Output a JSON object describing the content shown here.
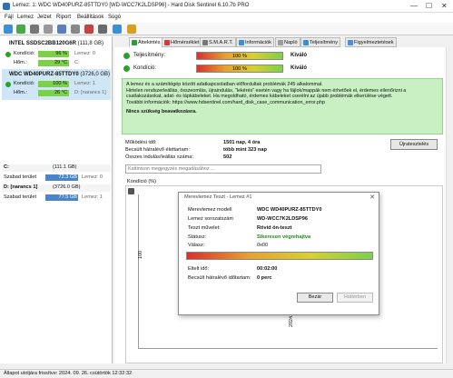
{
  "window": {
    "title": "Lemez: 1: WDC WD40PURZ-85TTDY0 [WD-WCC7K2LDSP96]  -  Hard Disk Sentinel 6.10.7b PRO",
    "controls": [
      "—",
      "☐",
      "✕"
    ]
  },
  "menu": [
    "Fájl",
    "Lemez",
    "Jelzet",
    "Riport",
    "Beállítások",
    "Súgó"
  ],
  "disks": [
    {
      "name": "INTEL SSDSC2BB120G6R",
      "size": "(111,8 GB)",
      "condition_label": "Kondíció:",
      "condition": "96 %",
      "condition_side": "Lemez: 0",
      "temp_label": "Hőm.:",
      "temp": "29 °C",
      "temp_side": "C:"
    },
    {
      "name": "WDC WD40PURZ-85TTDY0",
      "size": "(3726,0 GB)",
      "condition_label": "Kondíció:",
      "condition": "100 %",
      "condition_side": "Lemez: 1",
      "temp_label": "Hőm.:",
      "temp": "26 °C",
      "temp_side": "D: [narancs 1]"
    }
  ],
  "drives": [
    {
      "letter": "C:",
      "capacity": "(111.1 GB)",
      "free_label": "Szabad terület",
      "free": "72.3 GB",
      "disk": "Lemez: 0"
    },
    {
      "letter": "D: [narancs 1]",
      "capacity": "(3726.0 GB)",
      "free_label": "Szabad terület",
      "free": "77.5 GB",
      "disk": "Lemez: 1"
    }
  ],
  "tabs": [
    "Áttekintés",
    "Hőmérséklet",
    "S.M.A.R.T.",
    "Információk",
    "Napló",
    "Teljesítmény",
    "Figyelmeztetések"
  ],
  "overview": {
    "performance_label": "Teljesítmény:",
    "performance": "100 %",
    "performance_status": "Kiváló",
    "condition_label": "Kondíció:",
    "condition": "100 %",
    "condition_status": "Kiváló",
    "info_lines": [
      "A lemez és a számítógép között adatkapcsolatban előfordultak problémák 245 alkalommal.",
      "Hirtelen rendszerleállás, összeomlás, újraindulás, \"lekérés\" esetén vagy ha fájlok/mappák nem érhetőek el, érdemes ellenőrizni a",
      "csatlakozásokat, adat- és tápkábeleket. Ha megoldható, érdemes kábeleket cserélni az újabb problémák elkerülése végett.",
      "További információk: https://www.hdsentinel.com/hard_disk_case_communication_error.php"
    ],
    "info_note": "Nincs szükség beavatkozásra.",
    "power_on_label": "Működési idő:",
    "power_on": "1501 nap, 4 óra",
    "remaining_label": "Becsült hátralévő élettartam:",
    "remaining": "több mint 323 nap",
    "starts_label": "Összes indulás/leállás száma:",
    "starts": "502",
    "notify_button": "Újratesztelés",
    "comment_placeholder": "Kattintson megjegyzés megadásához ...",
    "chart_label": "Kondíció  (%)"
  },
  "chart_data": {
    "type": "line",
    "y_ticks": [
      "100"
    ],
    "x_ticks": [
      "2024. 09. 26."
    ]
  },
  "dialog": {
    "title": "Merevlemez Teszt - Lemez #1",
    "model_label": "Merevlemez modell",
    "model": "WDC WD40PURZ-85TTDY0",
    "serial_label": "Lemez sorozatszám",
    "serial": "WD-WCC7K2LDSP96",
    "op_label": "Teszt művelet:",
    "op": "Rövid ön-teszt",
    "status_label": "Státusz:",
    "status": "Sikeresen végrehajtva",
    "reply_label": "Válasz:",
    "reply": "0x00",
    "elapsed_label": "Eltelt idő:",
    "elapsed": "00:02:00",
    "remaining_label": "Becsült hátralévő időtartam:",
    "remaining": "0 perc",
    "close_button": "Bezár",
    "background_button": "Háttérben"
  },
  "status_bar": "Állapot utoljára frissítve: 2024. 09. 26. csütörtök 12:32:32"
}
